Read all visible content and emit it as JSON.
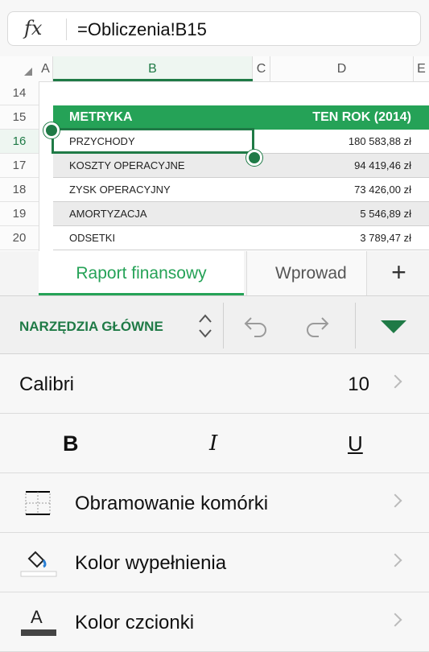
{
  "formula": {
    "fx_label": "fx",
    "text": "=Obliczenia!B15"
  },
  "sheet": {
    "columns": [
      "A",
      "B",
      "C",
      "D",
      "E"
    ],
    "rows": [
      "14",
      "15",
      "16",
      "17",
      "18",
      "19",
      "20"
    ],
    "table": {
      "header": {
        "label": "METRYKA",
        "value": "TEN ROK (2014)"
      },
      "rows": [
        {
          "label": "PRZYCHODY",
          "value": "180 583,88 zł"
        },
        {
          "label": "KOSZTY OPERACYJNE",
          "value": "94 419,46 zł"
        },
        {
          "label": "ZYSK OPERACYJNY",
          "value": "73 426,00 zł"
        },
        {
          "label": "AMORTYZACJA",
          "value": "5 546,89 zł"
        },
        {
          "label": "ODSETKI",
          "value": "3 789,47 zł"
        }
      ]
    }
  },
  "tabs": {
    "active": "Raport finansowy",
    "inactive": "Wprowad",
    "add": "+"
  },
  "ribbon": {
    "title": "NARZĘDZIA GŁÓWNE"
  },
  "font": {
    "name": "Calibri",
    "size": "10"
  },
  "format": {
    "bold": "B",
    "italic": "I",
    "underline": "U"
  },
  "options": [
    {
      "label": "Obramowanie komórki",
      "icon": "cell-border-icon"
    },
    {
      "label": "Kolor wypełnienia",
      "icon": "fill-color-icon"
    },
    {
      "label": "Kolor czcionki",
      "icon": "font-color-icon"
    }
  ],
  "colors": {
    "accent": "#1f7a46",
    "table_header": "#25a257"
  }
}
